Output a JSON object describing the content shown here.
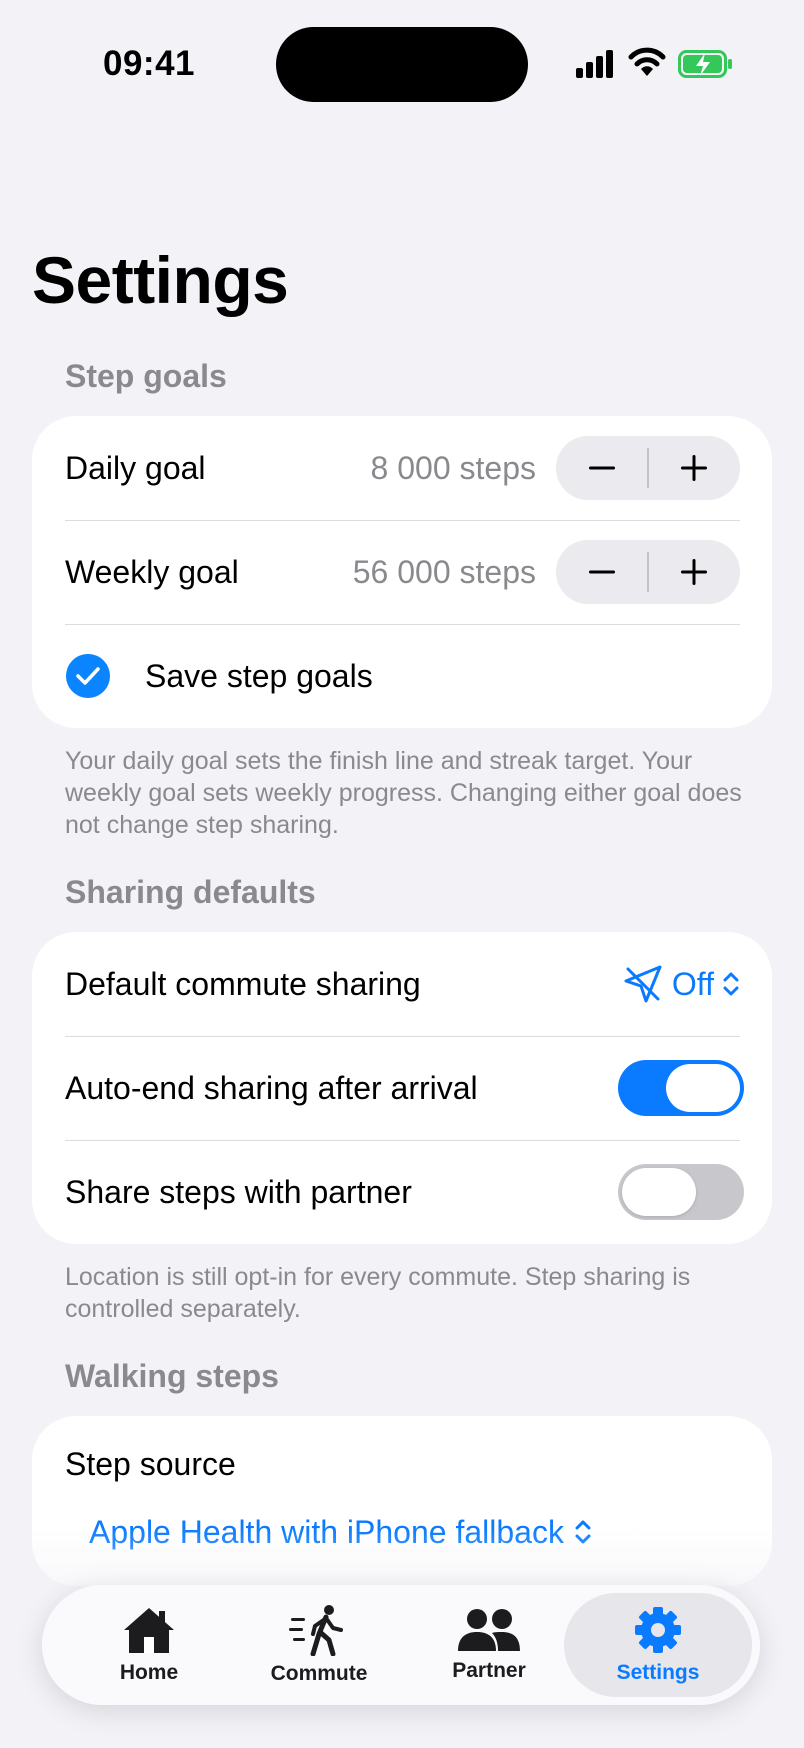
{
  "status_bar": {
    "time": "09:41"
  },
  "page": {
    "title": "Settings"
  },
  "step_goals": {
    "header": "Step goals",
    "daily": {
      "label": "Daily goal",
      "value": "8 000 steps"
    },
    "weekly": {
      "label": "Weekly goal",
      "value": "56 000 steps"
    },
    "save_label": "Save step goals",
    "footer": "Your daily goal sets the finish line and streak target. Your weekly goal sets weekly progress. Changing either goal does not change step sharing."
  },
  "sharing_defaults": {
    "header": "Sharing defaults",
    "commute": {
      "label": "Default commute sharing",
      "value": "Off"
    },
    "auto_end": {
      "label": "Auto-end sharing after arrival",
      "on": true
    },
    "share_steps": {
      "label": "Share steps with partner",
      "on": false
    },
    "footer": "Location is still opt-in for every commute. Step sharing is controlled separately."
  },
  "walking_steps": {
    "header": "Walking steps",
    "source": {
      "label": "Step source",
      "value": "Apple Health with iPhone fallback"
    }
  },
  "tabbar": {
    "tabs": [
      {
        "label": "Home",
        "icon": "house-icon"
      },
      {
        "label": "Commute",
        "icon": "walking-icon"
      },
      {
        "label": "Partner",
        "icon": "people-icon"
      },
      {
        "label": "Settings",
        "icon": "gear-icon",
        "active": true
      }
    ]
  },
  "colors": {
    "accent": "#0A7BFF",
    "background": "#F2F2F7",
    "secondary_text": "#8A8A8E",
    "battery": "#34C759"
  }
}
